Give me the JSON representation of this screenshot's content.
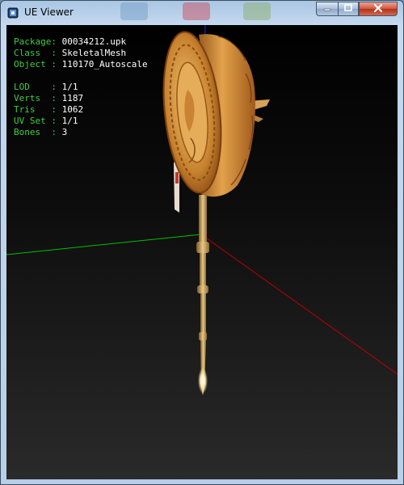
{
  "window": {
    "title": "UE Viewer",
    "app_icon": "ue-viewer-icon",
    "controls": {
      "minimize_icon": "minimize-icon",
      "maximize_icon": "maximize-icon",
      "close_icon": "close-icon"
    }
  },
  "info": {
    "header": [
      {
        "label": "Package",
        "value": "00034212.upk"
      },
      {
        "label": "Class  ",
        "value": "SkeletalMesh"
      },
      {
        "label": "Object ",
        "value": "110170_Autoscale"
      }
    ],
    "stats": [
      {
        "label": "LOD    ",
        "value": "1/1"
      },
      {
        "label": "Verts  ",
        "value": "1187"
      },
      {
        "label": "Tris   ",
        "value": "1062"
      },
      {
        "label": "UV Set ",
        "value": "1/1"
      },
      {
        "label": "Bones  ",
        "value": "3"
      }
    ]
  },
  "colors": {
    "label": "#3ecf3e",
    "value": "#ffffff",
    "axis_x": "#c00000",
    "axis_y": "#00c000",
    "axis_z": "#2020d0",
    "mesh": "#d99a3a"
  }
}
